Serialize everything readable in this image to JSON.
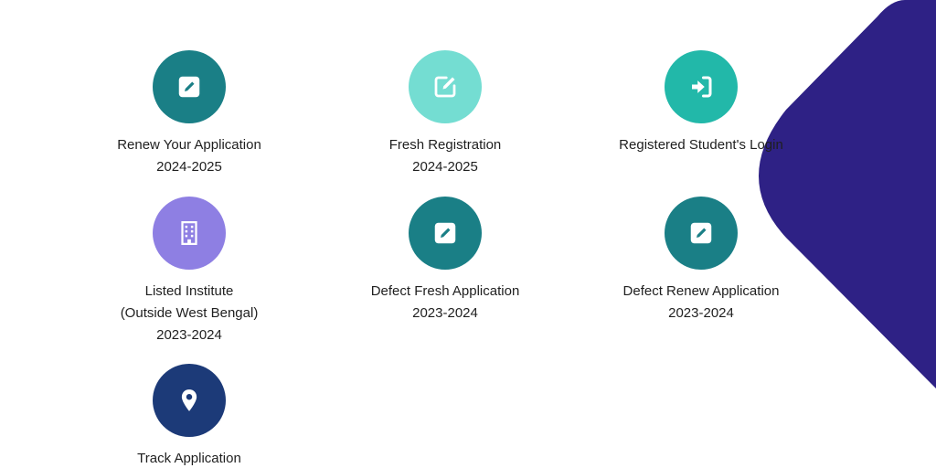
{
  "colors": {
    "teal_dark": "#1a7f86",
    "teal_light": "#74ddd2",
    "teal_mid": "#22b8a9",
    "purple": "#8e7fe3",
    "navy": "#1c3a78",
    "deco": "#2e2185"
  },
  "tiles": [
    {
      "lines": [
        "Renew Your Application",
        "2024-2025"
      ],
      "icon": "edit-square-icon",
      "color": "#1a7f86"
    },
    {
      "lines": [
        "Fresh Registration",
        "2024-2025"
      ],
      "icon": "edit-outline-icon",
      "color": "#74ddd2"
    },
    {
      "lines": [
        "Registered Student's Login"
      ],
      "icon": "sign-in-icon",
      "color": "#22b8a9"
    },
    {
      "lines": [
        "Listed Institute",
        "(Outside West Bengal)",
        "2023-2024"
      ],
      "icon": "building-icon",
      "color": "#8e7fe3"
    },
    {
      "lines": [
        "Defect Fresh Application",
        "2023-2024"
      ],
      "icon": "edit-square-icon",
      "color": "#1a7f86"
    },
    {
      "lines": [
        "Defect Renew Application",
        "2023-2024"
      ],
      "icon": "edit-square-icon",
      "color": "#1a7f86"
    },
    {
      "lines": [
        "Track Application"
      ],
      "icon": "map-marker-icon",
      "color": "#1c3a78"
    }
  ]
}
